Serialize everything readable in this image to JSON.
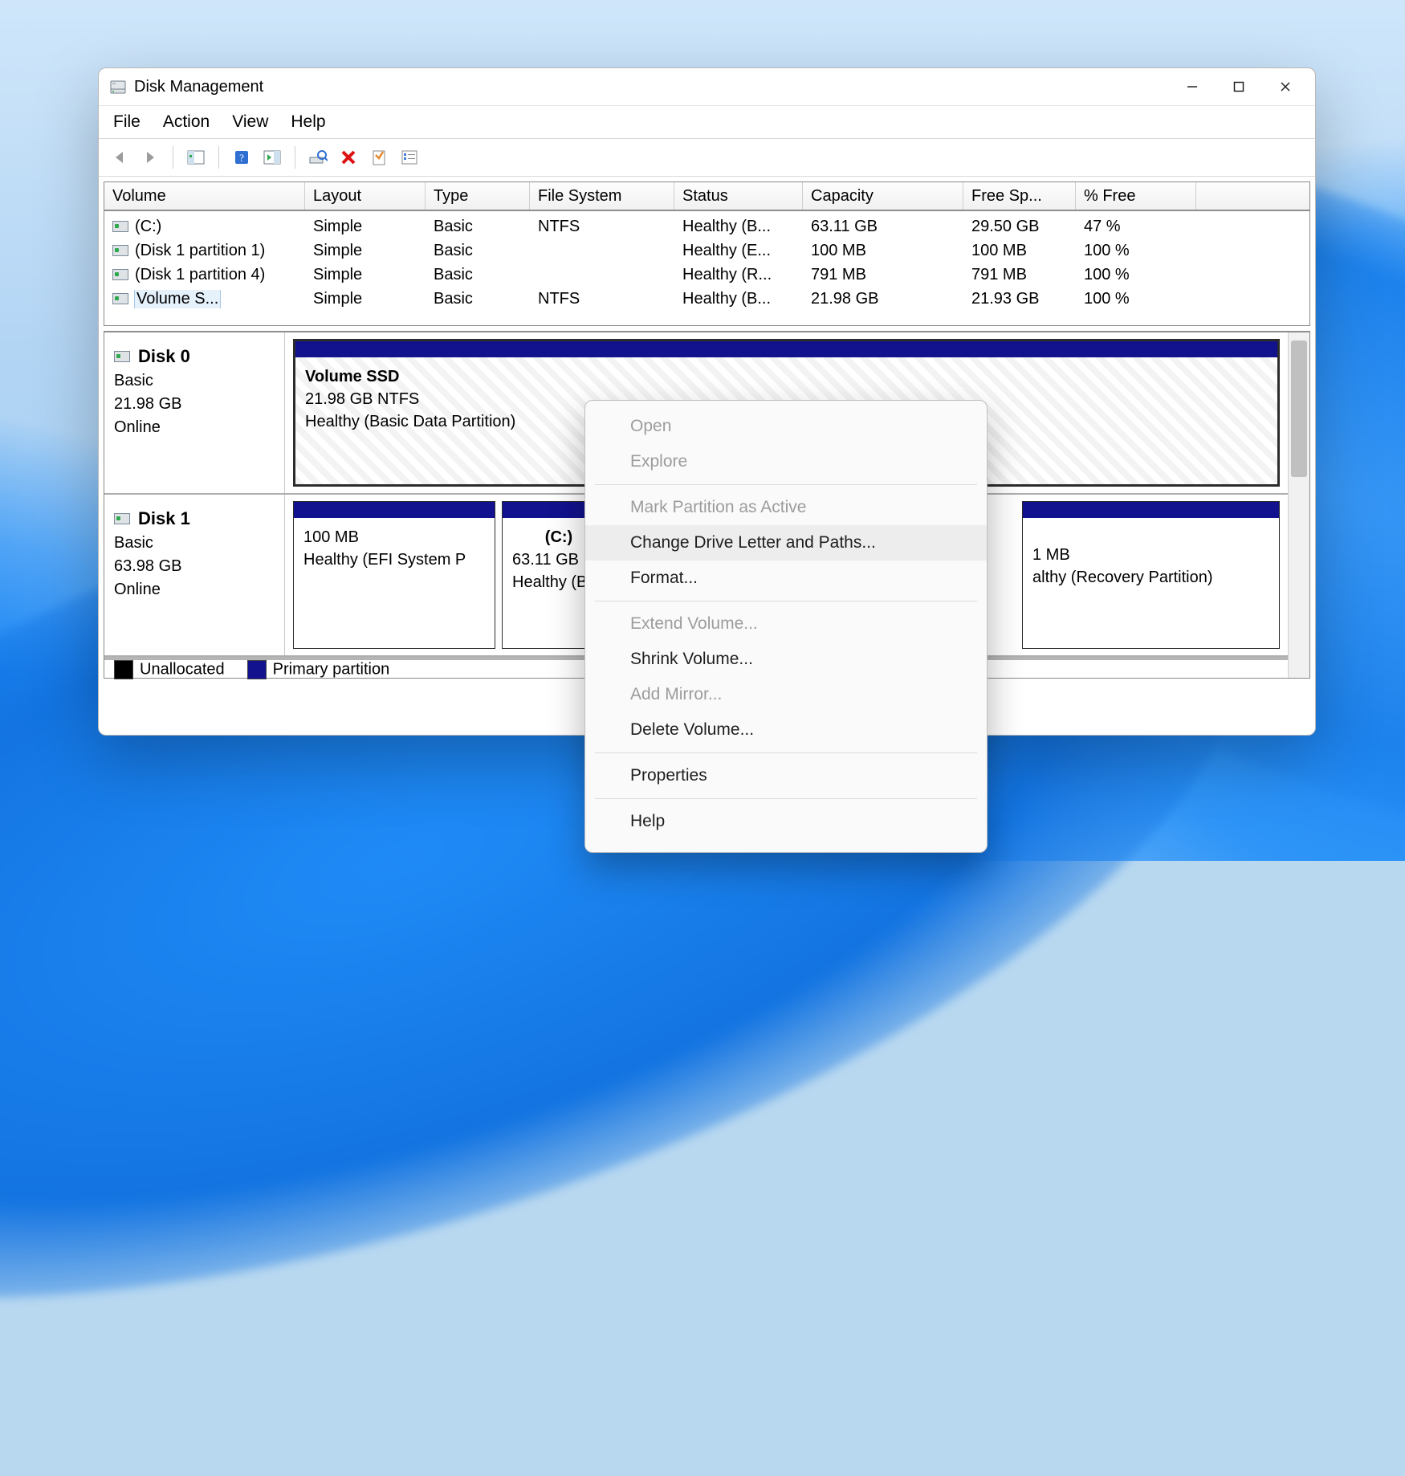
{
  "window": {
    "title": "Disk Management"
  },
  "menubar": {
    "file": "File",
    "action": "Action",
    "view": "View",
    "help": "Help"
  },
  "columns": {
    "volume": "Volume",
    "layout": "Layout",
    "type": "Type",
    "fs": "File System",
    "status": "Status",
    "capacity": "Capacity",
    "free": "Free Sp...",
    "pct": "% Free"
  },
  "volumes": [
    {
      "name": "(C:)",
      "layout": "Simple",
      "type": "Basic",
      "fs": "NTFS",
      "status": "Healthy (B...",
      "capacity": "63.11 GB",
      "free": "29.50 GB",
      "pct": "47 %"
    },
    {
      "name": "(Disk 1 partition 1)",
      "layout": "Simple",
      "type": "Basic",
      "fs": "",
      "status": "Healthy (E...",
      "capacity": "100 MB",
      "free": "100 MB",
      "pct": "100 %"
    },
    {
      "name": "(Disk 1 partition 4)",
      "layout": "Simple",
      "type": "Basic",
      "fs": "",
      "status": "Healthy (R...",
      "capacity": "791 MB",
      "free": "791 MB",
      "pct": "100 %"
    },
    {
      "name": "Volume S...",
      "selected": true,
      "layout": "Simple",
      "type": "Basic",
      "fs": "NTFS",
      "status": "Healthy (B...",
      "capacity": "21.98 GB",
      "free": "21.93 GB",
      "pct": "100 %"
    }
  ],
  "disks": {
    "d0": {
      "title": "Disk 0",
      "type": "Basic",
      "size": "21.98 GB",
      "state": "Online",
      "p0": {
        "title": "Volume SSD",
        "line1": "21.98 GB NTFS",
        "line2": "Healthy (Basic Data Partition)"
      }
    },
    "d1": {
      "title": "Disk 1",
      "type": "Basic",
      "size": "63.98 GB",
      "state": "Online",
      "p0": {
        "title": "",
        "line1": "100 MB",
        "line2": "Healthy (EFI System P"
      },
      "p1": {
        "title": "(C:)",
        "line1": "63.11 GB N",
        "line2": "Healthy (Bo"
      },
      "p2": {
        "title": "",
        "line1": "1 MB",
        "line2": "althy (Recovery Partition)"
      }
    }
  },
  "legend": {
    "unalloc": "Unallocated",
    "primary": "Primary partition"
  },
  "context": {
    "open": "Open",
    "explore": "Explore",
    "markactive": "Mark Partition as Active",
    "change": "Change Drive Letter and Paths...",
    "format": "Format...",
    "extend": "Extend Volume...",
    "shrink": "Shrink Volume...",
    "addmirror": "Add Mirror...",
    "delete": "Delete Volume...",
    "properties": "Properties",
    "help": "Help"
  }
}
